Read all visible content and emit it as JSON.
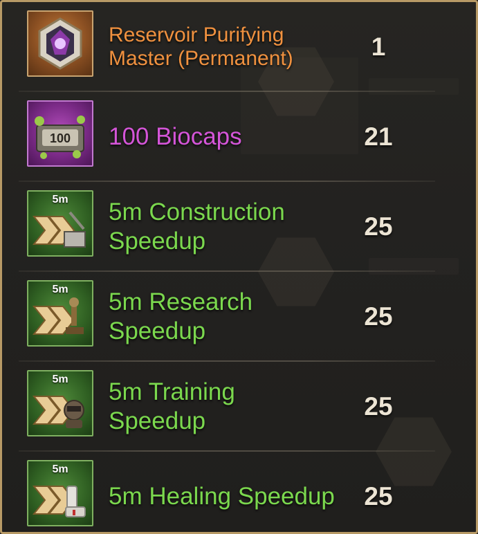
{
  "rewards": [
    {
      "name": "Reservoir Purifying Master (Permanent)",
      "quantity": "1",
      "rarity_color": "#f0913f",
      "icon": "purifier-badge-icon",
      "tag": ""
    },
    {
      "name": "100 Biocaps",
      "quantity": "21",
      "rarity_color": "#d455d8",
      "icon": "biocaps-crate-icon",
      "tag": "100"
    },
    {
      "name": "5m Construction Speedup",
      "quantity": "25",
      "rarity_color": "#7bd84e",
      "icon": "construction-speedup-icon",
      "tag": "5m"
    },
    {
      "name": "5m Research Speedup",
      "quantity": "25",
      "rarity_color": "#7bd84e",
      "icon": "research-speedup-icon",
      "tag": "5m"
    },
    {
      "name": "5m Training Speedup",
      "quantity": "25",
      "rarity_color": "#7bd84e",
      "icon": "training-speedup-icon",
      "tag": "5m"
    },
    {
      "name": "5m Healing Speedup",
      "quantity": "25",
      "rarity_color": "#7bd84e",
      "icon": "healing-speedup-icon",
      "tag": "5m"
    }
  ]
}
